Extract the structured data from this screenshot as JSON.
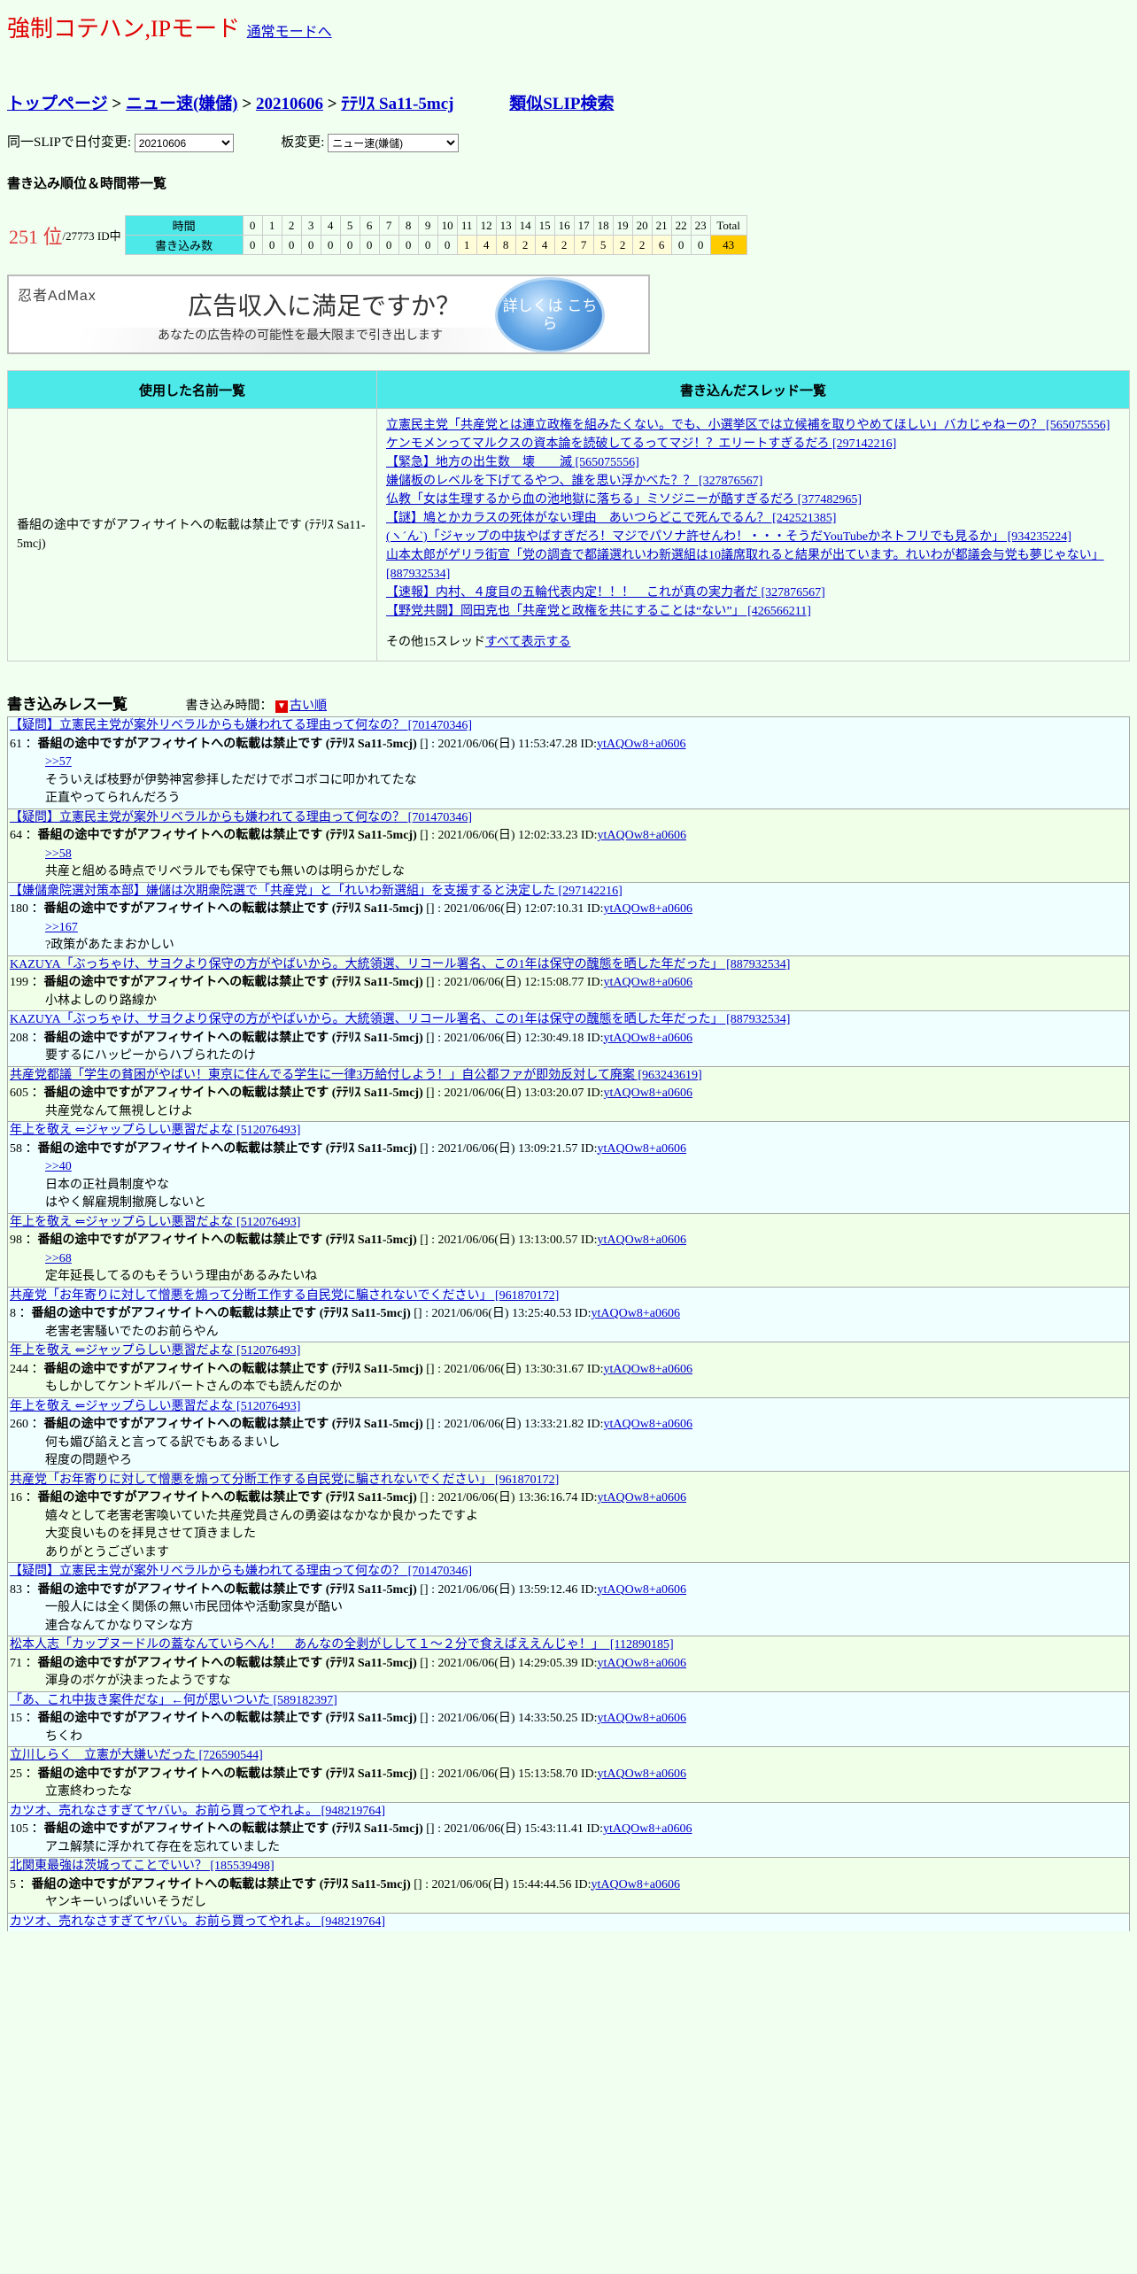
{
  "header": {
    "title": "強制コテハン,IPモード",
    "normal_mode_link": "通常モードへ"
  },
  "breadcrumb": {
    "top": "トップページ",
    "board": "ニュー速(嫌儲)",
    "date": "20210606",
    "slip": "ﾃﾃﾘｽ Sa11-5mcj",
    "similar_search": "類似SLIP検索",
    "sep": ">"
  },
  "selectors": {
    "date_label": "同一SLIPで日付変更:",
    "date_value": "20210606",
    "board_label": "板変更:",
    "board_value": "ニュー速(嫌儲)"
  },
  "ranking": {
    "heading": "書き込み順位＆時間帯一覧",
    "rank": "251 位",
    "total_ids": "/27773 ID中",
    "hours_label": "時間",
    "count_label": "書き込み数",
    "hours": [
      "0",
      "1",
      "2",
      "3",
      "4",
      "5",
      "6",
      "7",
      "8",
      "9",
      "10",
      "11",
      "12",
      "13",
      "14",
      "15",
      "16",
      "17",
      "18",
      "19",
      "20",
      "21",
      "22",
      "23"
    ],
    "counts": [
      "0",
      "0",
      "0",
      "0",
      "0",
      "0",
      "0",
      "0",
      "0",
      "0",
      "0",
      "1",
      "4",
      "8",
      "2",
      "4",
      "2",
      "7",
      "5",
      "2",
      "2",
      "6",
      "0",
      "0"
    ],
    "total_label": "Total",
    "total_value": "43"
  },
  "ad": {
    "logo": "忍者AdMax",
    "title": "広告収入に満足ですか？",
    "subtitle": "あなたの広告枠の可能性を最大限まで引き出します",
    "badge": "詳しくは こちら"
  },
  "info_table": {
    "names_header": "使用した名前一覧",
    "threads_header": "書き込んだスレッド一覧",
    "name": "番組の途中ですがアフィサイトへの転載は禁止です (ﾃﾃﾘｽ Sa11-5mcj)",
    "threads": [
      "立憲民主党「共産党とは連立政権を組みたくない。でも、小選挙区では立候補を取りやめてほしい」バカじゃねーの？ [565075556]",
      "ケンモメンってマルクスの資本論を読破してるってマジ！？エリートすぎるだろ [297142216]",
      "【緊急】地方の出生数　壊　　滅 [565075556]",
      "嫌儲板のレベルを下げてるやつ、誰を思い浮かべた？？ [327876567]",
      "仏教「女は生理するから血の池地獄に落ちる」ミソジニーが酷すぎるだろ [377482965]",
      "【謎】鳩とかカラスの死体がない理由　あいつらどこで死んでるん？ [242521385]",
      "(ヽ´ん`)「ジャップの中抜やばすぎだろ！マジでパソナ許せんわ！・・・そうだYouTubeかネトフリでも見るか」 [934235224]",
      "山本太郎がゲリラ街宣「党の調査で都議選れいわ新選組は10議席取れると結果が出ています。れいわが都議会与党も夢じゃない」 [887932534]",
      "【速報】内村、４度目の五輪代表内定！！！　これが真の実力者だ [327876567]",
      "【野党共闘】岡田克也「共産党と政権を共にすることは“ない”」 [426566211]"
    ],
    "more_prefix": "その他15スレッド",
    "more_link": "すべて表示する"
  },
  "posts_section": {
    "title": "書き込みレス一覧",
    "time_label": "書き込み時間：",
    "sort_link": "古い順"
  },
  "posts": [
    {
      "thread": "【疑問】立憲民主党が案外リベラルからも嫌われてる理由って何なの？ [701470346]",
      "no": "61",
      "name": "番組の途中ですがアフィサイトへの転載は禁止です (ﾃﾃﾘｽ Sa11-5mcj)",
      "date": "[] : 2021/06/06(日) 11:53:47.28 ID:",
      "id": "ytAQOw8+a0606",
      "body": [
        ">>57",
        "そういえば枝野が伊勢神宮参拝しただけでボコボコに叩かれてたな",
        "正直やってられんだろう"
      ]
    },
    {
      "thread": "【疑問】立憲民主党が案外リベラルからも嫌われてる理由って何なの？ [701470346]",
      "no": "64",
      "name": "番組の途中ですがアフィサイトへの転載は禁止です (ﾃﾃﾘｽ Sa11-5mcj)",
      "date": "[] : 2021/06/06(日) 12:02:33.23 ID:",
      "id": "ytAQOw8+a0606",
      "body": [
        ">>58",
        "共産と組める時点でリベラルでも保守でも無いのは明らかだしな"
      ]
    },
    {
      "thread": "【嫌儲衆院選対策本部】嫌儲は次期衆院選で「共産党」と「れいわ新選組」を支援すると決定した [297142216]",
      "no": "180",
      "name": "番組の途中ですがアフィサイトへの転載は禁止です (ﾃﾃﾘｽ Sa11-5mcj)",
      "date": "[] : 2021/06/06(日) 12:07:10.31 ID:",
      "id": "ytAQOw8+a0606",
      "body": [
        ">>167",
        "?政策があたまおかしい"
      ]
    },
    {
      "thread": "KAZUYA「ぶっちゃけ、サヨクより保守の方がやばいから。大統領選、リコール署名、この1年は保守の醜態を晒した年だった」 [887932534]",
      "no": "199",
      "name": "番組の途中ですがアフィサイトへの転載は禁止です (ﾃﾃﾘｽ Sa11-5mcj)",
      "date": "[] : 2021/06/06(日) 12:15:08.77 ID:",
      "id": "ytAQOw8+a0606",
      "body": [
        "小林よしのり路線か"
      ]
    },
    {
      "thread": "KAZUYA「ぶっちゃけ、サヨクより保守の方がやばいから。大統領選、リコール署名、この1年は保守の醜態を晒した年だった」 [887932534]",
      "no": "208",
      "name": "番組の途中ですがアフィサイトへの転載は禁止です (ﾃﾃﾘｽ Sa11-5mcj)",
      "date": "[] : 2021/06/06(日) 12:30:49.18 ID:",
      "id": "ytAQOw8+a0606",
      "body": [
        "要するにハッピーからハブられたのけ"
      ]
    },
    {
      "thread": "共産党都議「学生の貧困がやばい！東京に住んでる学生に一律3万給付しよう！」自公都ファが即効反対して廃案 [963243619]",
      "no": "605",
      "name": "番組の途中ですがアフィサイトへの転載は禁止です (ﾃﾃﾘｽ Sa11-5mcj)",
      "date": "[] : 2021/06/06(日) 13:03:20.07 ID:",
      "id": "ytAQOw8+a0606",
      "body": [
        "共産党なんて無視しとけよ"
      ]
    },
    {
      "thread": "年上を敬え ⇐ジャップらしい悪習だよな [512076493]",
      "no": "58",
      "name": "番組の途中ですがアフィサイトへの転載は禁止です (ﾃﾃﾘｽ Sa11-5mcj)",
      "date": "[] : 2021/06/06(日) 13:09:21.57 ID:",
      "id": "ytAQOw8+a0606",
      "body": [
        ">>40",
        "日本の正社員制度やな",
        "はやく解雇規制撤廃しないと"
      ]
    },
    {
      "thread": "年上を敬え ⇐ジャップらしい悪習だよな [512076493]",
      "no": "98",
      "name": "番組の途中ですがアフィサイトへの転載は禁止です (ﾃﾃﾘｽ Sa11-5mcj)",
      "date": "[] : 2021/06/06(日) 13:13:00.57 ID:",
      "id": "ytAQOw8+a0606",
      "body": [
        ">>68",
        "定年延長してるのもそういう理由があるみたいね"
      ]
    },
    {
      "thread": "共産党「お年寄りに対して憎悪を煽って分断工作する自民党に騙されないでください」 [961870172]",
      "no": "8",
      "name": "番組の途中ですがアフィサイトへの転載は禁止です (ﾃﾃﾘｽ Sa11-5mcj)",
      "date": "[] : 2021/06/06(日) 13:25:40.53 ID:",
      "id": "ytAQOw8+a0606",
      "body": [
        "老害老害騒いでたのお前らやん"
      ]
    },
    {
      "thread": "年上を敬え ⇐ジャップらしい悪習だよな [512076493]",
      "no": "244",
      "name": "番組の途中ですがアフィサイトへの転載は禁止です (ﾃﾃﾘｽ Sa11-5mcj)",
      "date": "[] : 2021/06/06(日) 13:30:31.67 ID:",
      "id": "ytAQOw8+a0606",
      "body": [
        "もしかしてケントギルバートさんの本でも読んだのか"
      ]
    },
    {
      "thread": "年上を敬え ⇐ジャップらしい悪習だよな [512076493]",
      "no": "260",
      "name": "番組の途中ですがアフィサイトへの転載は禁止です (ﾃﾃﾘｽ Sa11-5mcj)",
      "date": "[] : 2021/06/06(日) 13:33:21.82 ID:",
      "id": "ytAQOw8+a0606",
      "body": [
        "何も媚び諂えと言ってる訳でもあるまいし",
        "程度の問題やろ"
      ]
    },
    {
      "thread": "共産党「お年寄りに対して憎悪を煽って分断工作する自民党に騙されないでください」 [961870172]",
      "no": "16",
      "name": "番組の途中ですがアフィサイトへの転載は禁止です (ﾃﾃﾘｽ Sa11-5mcj)",
      "date": "[] : 2021/06/06(日) 13:36:16.74 ID:",
      "id": "ytAQOw8+a0606",
      "body": [
        "嬉々として老害老害喚いていた共産党員さんの勇姿はなかなか良かったですよ",
        "大変良いものを拝見させて頂きました",
        "ありがとうございます"
      ]
    },
    {
      "thread": "【疑問】立憲民主党が案外リベラルからも嫌われてる理由って何なの？ [701470346]",
      "no": "83",
      "name": "番組の途中ですがアフィサイトへの転載は禁止です (ﾃﾃﾘｽ Sa11-5mcj)",
      "date": "[] : 2021/06/06(日) 13:59:12.46 ID:",
      "id": "ytAQOw8+a0606",
      "body": [
        "一般人には全く関係の無い市民団体や活動家臭が酷い",
        "連合なんてかなりマシな方"
      ]
    },
    {
      "thread": "松本人志「カップヌードルの蓋なんていらへん！　あんなの全剥がしして１～２分で食えばええんじゃ！」　[112890185]",
      "no": "71",
      "name": "番組の途中ですがアフィサイトへの転載は禁止です (ﾃﾃﾘｽ Sa11-5mcj)",
      "date": "[] : 2021/06/06(日) 14:29:05.39 ID:",
      "id": "ytAQOw8+a0606",
      "body": [
        "渾身のボケが決まったようですな"
      ]
    },
    {
      "thread": "「あ、これ中抜き案件だな」←何が思いついた [589182397]",
      "no": "15",
      "name": "番組の途中ですがアフィサイトへの転載は禁止です (ﾃﾃﾘｽ Sa11-5mcj)",
      "date": "[] : 2021/06/06(日) 14:33:50.25 ID:",
      "id": "ytAQOw8+a0606",
      "body": [
        "ちくわ"
      ]
    },
    {
      "thread": "立川しらく　立憲が大嫌いだった [726590544]",
      "no": "25",
      "name": "番組の途中ですがアフィサイトへの転載は禁止です (ﾃﾃﾘｽ Sa11-5mcj)",
      "date": "[] : 2021/06/06(日) 15:13:58.70 ID:",
      "id": "ytAQOw8+a0606",
      "body": [
        "立憲終わったな"
      ]
    },
    {
      "thread": "カツオ、売れなさすぎてヤバい。お前ら買ってやれよ。 [948219764]",
      "no": "105",
      "name": "番組の途中ですがアフィサイトへの転載は禁止です (ﾃﾃﾘｽ Sa11-5mcj)",
      "date": "[] : 2021/06/06(日) 15:43:11.41 ID:",
      "id": "ytAQOw8+a0606",
      "body": [
        "アユ解禁に浮かれて存在を忘れていました"
      ]
    },
    {
      "thread": "北関東最強は茨城ってことでいい？ [185539498]",
      "no": "5",
      "name": "番組の途中ですがアフィサイトへの転載は禁止です (ﾃﾃﾘｽ Sa11-5mcj)",
      "date": "[] : 2021/06/06(日) 15:44:44.56 ID:",
      "id": "ytAQOw8+a0606",
      "body": [
        "ヤンキーいっぱいいそうだし"
      ]
    },
    {
      "thread": "カツオ、売れなさすぎてヤバい。お前ら買ってやれよ。 [948219764]",
      "no": "",
      "name": "",
      "date": "",
      "id": "",
      "body": []
    }
  ]
}
